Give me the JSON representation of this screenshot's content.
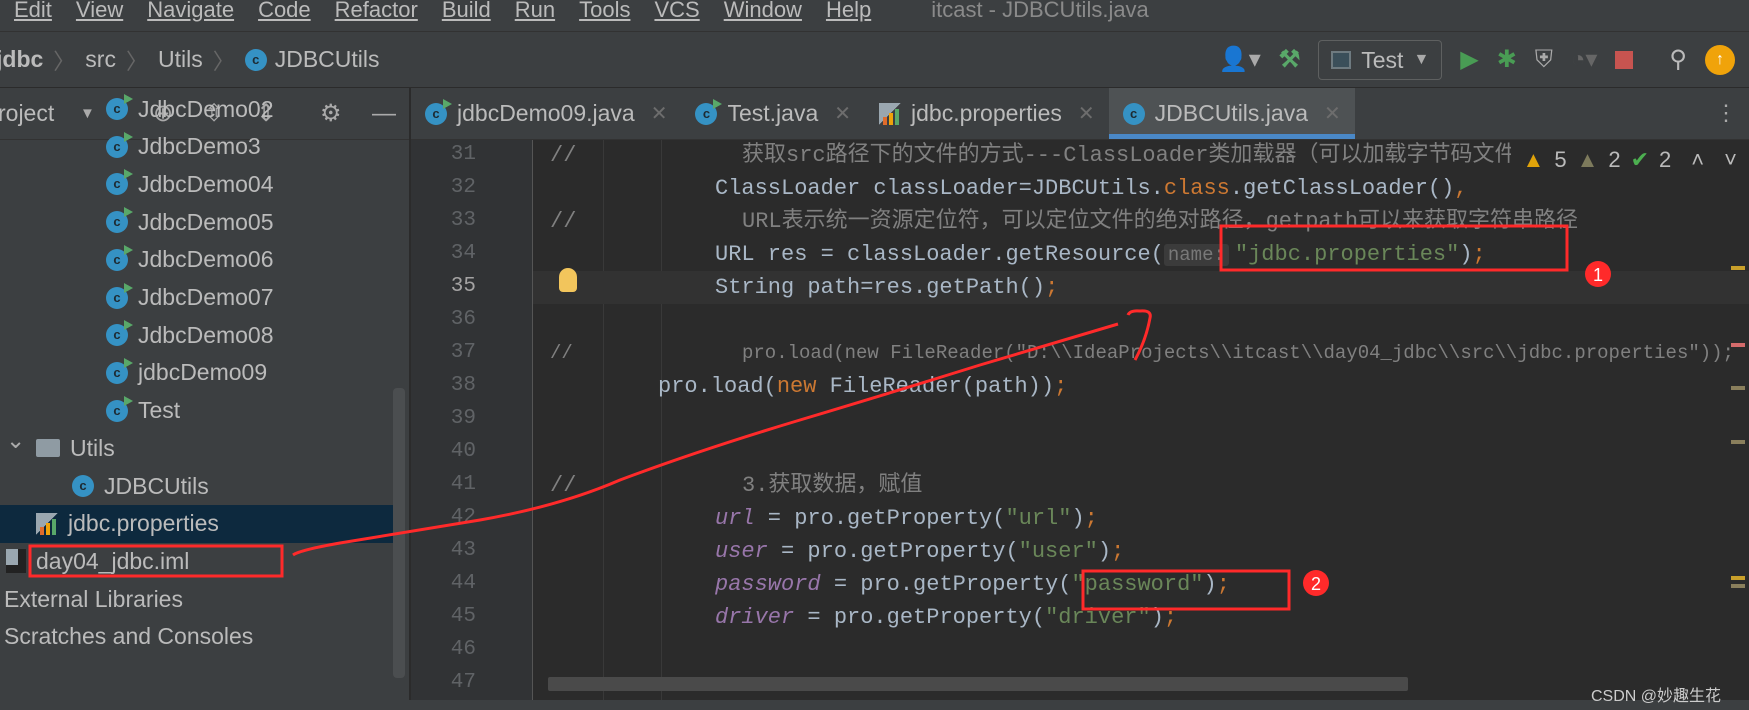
{
  "menu": {
    "items": [
      "Edit",
      "View",
      "Navigate",
      "Code",
      "Refactor",
      "Build",
      "Run",
      "Tools",
      "VCS",
      "Window",
      "Help"
    ],
    "window_title": "itcast - JDBCUtils.java"
  },
  "breadcrumb": [
    "jdbc",
    "src",
    "Utils",
    "JDBCUtils"
  ],
  "toolbar": {
    "run_config": "Test"
  },
  "project": {
    "header": "roject",
    "items": [
      {
        "label": "JdbcDemo02",
        "kind": "run-class",
        "depth": 2
      },
      {
        "label": "JdbcDemo3",
        "kind": "run-class",
        "depth": 2
      },
      {
        "label": "JdbcDemo04",
        "kind": "run-class",
        "depth": 2
      },
      {
        "label": "JdbcDemo05",
        "kind": "run-class",
        "depth": 2
      },
      {
        "label": "JdbcDemo06",
        "kind": "run-class",
        "depth": 2
      },
      {
        "label": "JdbcDemo07",
        "kind": "run-class",
        "depth": 2
      },
      {
        "label": "JdbcDemo08",
        "kind": "run-class",
        "depth": 2
      },
      {
        "label": "jdbcDemo09",
        "kind": "run-class",
        "depth": 2
      },
      {
        "label": "Test",
        "kind": "run-class",
        "depth": 2
      },
      {
        "label": "Utils",
        "kind": "folder",
        "depth": 0
      },
      {
        "label": "JDBCUtils",
        "kind": "class",
        "depth": 1
      },
      {
        "label": "jdbc.properties",
        "kind": "properties",
        "depth": 0,
        "selected": true
      },
      {
        "label": "day04_jdbc.iml",
        "kind": "iml",
        "depth": -1
      },
      {
        "label": "External Libraries",
        "kind": "none",
        "depth": -2
      },
      {
        "label": "Scratches and Consoles",
        "kind": "none",
        "depth": -2
      }
    ]
  },
  "tabs": [
    {
      "label": "jdbcDemo09.java",
      "kind": "run-class"
    },
    {
      "label": "Test.java",
      "kind": "run-class"
    },
    {
      "label": "jdbc.properties",
      "kind": "properties"
    },
    {
      "label": "JDBCUtils.java",
      "kind": "class",
      "active": true
    }
  ],
  "inspections": {
    "warnings": "5",
    "weak_warnings": "2",
    "typos": "2"
  },
  "code": {
    "current_line": 35,
    "lines": [
      {
        "n": "31",
        "indent": "cm",
        "tokens": [
          {
            "t": "//",
            "c": "cmt",
            "slash": true
          },
          {
            "t": "获取src路径下的文件的方式---ClassLoader类加载器（可以加载字节码文件进内存）",
            "c": "cmt"
          }
        ]
      },
      {
        "n": "32",
        "indent": "2",
        "tokens": [
          {
            "t": "ClassLoader classLoader=JDBCUtils.",
            "c": "def"
          },
          {
            "t": "class",
            "c": "kw"
          },
          {
            "t": ".getClassLoader()",
            "c": "def"
          },
          {
            "t": ",",
            "c": "kw"
          }
        ]
      },
      {
        "n": "33",
        "indent": "cm",
        "tokens": [
          {
            "t": "//",
            "c": "cmt",
            "slash": true
          },
          {
            "t": "URL表示统一资源定位符，可以定位文件的绝对路径，getpath可以来获取字符串路径",
            "c": "cmt"
          }
        ]
      },
      {
        "n": "34",
        "indent": "2",
        "tokens": [
          {
            "t": "URL res = classLoader.getResource(",
            "c": "def"
          },
          {
            "t": "name:",
            "c": "hint"
          },
          {
            "t": "\"jdbc.properties\"",
            "c": "str"
          },
          {
            "t": ")",
            "c": "def"
          },
          {
            "t": ";",
            "c": "kw"
          }
        ]
      },
      {
        "n": "35",
        "indent": "2",
        "tokens": [
          {
            "t": "String path=res.getPath()",
            "c": "def"
          },
          {
            "t": ";",
            "c": "kw"
          }
        ]
      },
      {
        "n": "36",
        "indent": "2",
        "tokens": []
      },
      {
        "n": "37",
        "indent": "cm",
        "tokens": [
          {
            "t": "//",
            "c": "cmt",
            "slash": true
          },
          {
            "t": "pro.load(new FileReader(\"D:\\\\IdeaProjects\\\\itcast\\\\day04_jdbc\\\\src\\\\jdbc.properties\"));",
            "c": "cmt"
          }
        ]
      },
      {
        "n": "38",
        "indent": "1",
        "tokens": [
          {
            "t": "pro.load(",
            "c": "def"
          },
          {
            "t": "new ",
            "c": "kw"
          },
          {
            "t": "FileReader(path))",
            "c": "def"
          },
          {
            "t": ";",
            "c": "kw"
          }
        ]
      },
      {
        "n": "39",
        "indent": "2",
        "tokens": []
      },
      {
        "n": "40",
        "indent": "2",
        "tokens": []
      },
      {
        "n": "41",
        "indent": "cm",
        "tokens": [
          {
            "t": "//",
            "c": "cmt",
            "slash": true
          },
          {
            "t": "3.获取数据，赋值",
            "c": "cmt"
          }
        ]
      },
      {
        "n": "42",
        "indent": "2",
        "tokens": [
          {
            "t": "url",
            "c": "fld"
          },
          {
            "t": " = pro.getProperty(",
            "c": "def"
          },
          {
            "t": "\"url\"",
            "c": "str"
          },
          {
            "t": ")",
            "c": "def"
          },
          {
            "t": ";",
            "c": "kw"
          }
        ]
      },
      {
        "n": "43",
        "indent": "2",
        "tokens": [
          {
            "t": "user",
            "c": "fld"
          },
          {
            "t": " = pro.getProperty(",
            "c": "def"
          },
          {
            "t": "\"user\"",
            "c": "str"
          },
          {
            "t": ")",
            "c": "def"
          },
          {
            "t": ";",
            "c": "kw"
          }
        ]
      },
      {
        "n": "44",
        "indent": "2",
        "tokens": [
          {
            "t": "password",
            "c": "fld"
          },
          {
            "t": " = pro.getProperty(",
            "c": "def"
          },
          {
            "t": "\"password\"",
            "c": "str"
          },
          {
            "t": ")",
            "c": "def"
          },
          {
            "t": ";",
            "c": "kw"
          }
        ]
      },
      {
        "n": "45",
        "indent": "2",
        "tokens": [
          {
            "t": "driver",
            "c": "fld"
          },
          {
            "t": " = pro.getProperty(",
            "c": "def"
          },
          {
            "t": "\"driver\"",
            "c": "str"
          },
          {
            "t": ")",
            "c": "def"
          },
          {
            "t": ";",
            "c": "kw"
          }
        ]
      },
      {
        "n": "46",
        "indent": "2",
        "tokens": []
      },
      {
        "n": "47",
        "indent": "2",
        "tokens": []
      }
    ]
  },
  "annotations": {
    "marker1": "1",
    "marker2": "2"
  },
  "watermark": "CSDN @妙趣生花",
  "colors": {
    "kw": "#cc7832",
    "str": "#6a8759",
    "fld": "#9876aa",
    "cmt": "#808080",
    "def": "#a9b7c6",
    "annotation": "#ff2a2a"
  }
}
